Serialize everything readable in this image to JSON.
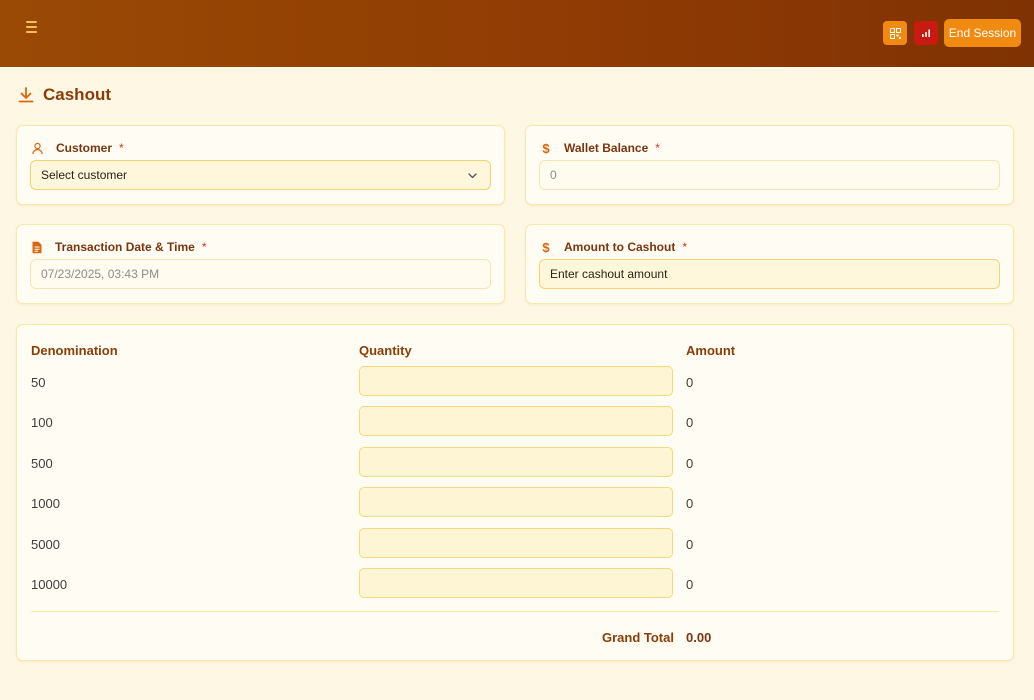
{
  "header": {
    "menu_icon": "hamburger-menu-icon",
    "qr_icon": "qr-code-icon",
    "chart_icon": "bar-chart-icon",
    "end_session_label": "End Session",
    "colors": {
      "bar": "#8f3a04",
      "accent": "#f08a10",
      "danger": "#c81a10"
    }
  },
  "page": {
    "title": "Cashout",
    "title_icon": "download-icon"
  },
  "form": {
    "customer": {
      "label": "Customer",
      "required": "*",
      "icon": "user-icon",
      "value": "Select customer"
    },
    "wallet_balance": {
      "label": "Wallet Balance",
      "required": "*",
      "icon": "dollar-icon",
      "value": "0"
    },
    "transaction_datetime": {
      "label": "Transaction Date & Time",
      "required": "*",
      "icon": "document-icon",
      "value": "07/23/2025, 03:43 PM"
    },
    "cashout_amount": {
      "label": "Amount to Cashout",
      "required": "*",
      "icon": "dollar-icon",
      "placeholder": "Enter cashout amount"
    }
  },
  "denominations": {
    "headers": [
      "Denomination",
      "Quantity",
      "Amount"
    ],
    "rows": [
      {
        "denomination": "50",
        "quantity": "",
        "amount": "0"
      },
      {
        "denomination": "100",
        "quantity": "",
        "amount": "0"
      },
      {
        "denomination": "500",
        "quantity": "",
        "amount": "0"
      },
      {
        "denomination": "1000",
        "quantity": "",
        "amount": "0"
      },
      {
        "denomination": "5000",
        "quantity": "",
        "amount": "0"
      },
      {
        "denomination": "10000",
        "quantity": "",
        "amount": "0"
      }
    ],
    "grand_total_label": "Grand Total",
    "grand_total_value": "0.00"
  }
}
